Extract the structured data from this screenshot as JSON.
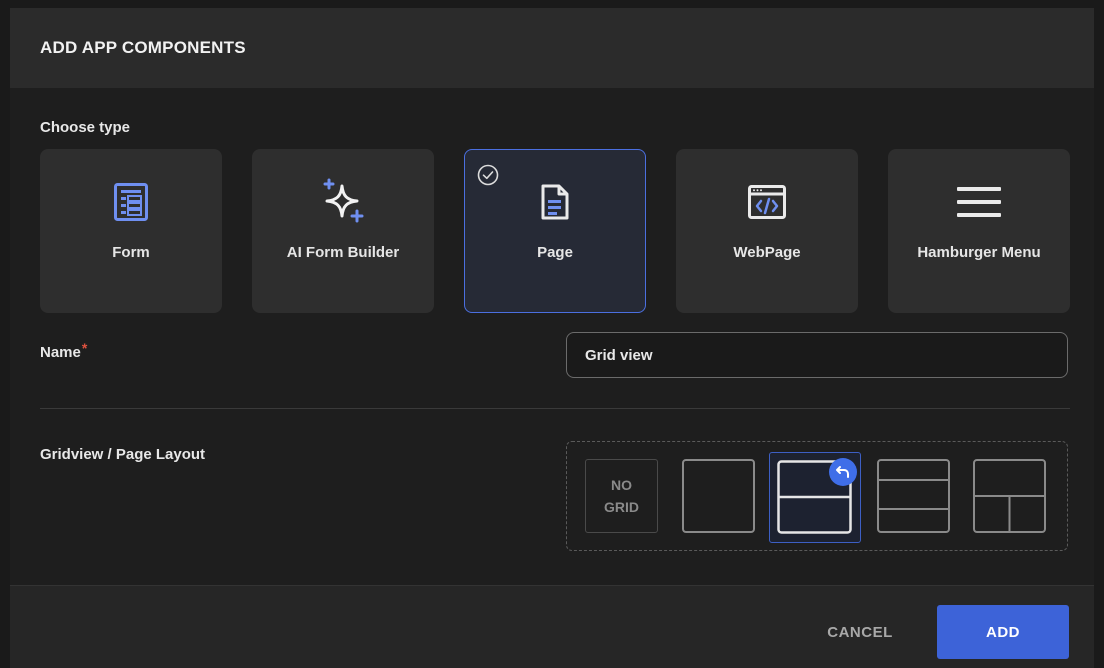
{
  "dialog": {
    "title": "ADD APP COMPONENTS"
  },
  "choose_type": {
    "label": "Choose type",
    "selected": "Page",
    "items": [
      {
        "label": "Form",
        "icon": "form-icon"
      },
      {
        "label": "AI Form Builder",
        "icon": "sparkle-icon"
      },
      {
        "label": "Page",
        "icon": "page-icon"
      },
      {
        "label": "WebPage",
        "icon": "webpage-icon"
      },
      {
        "label": "Hamburger Menu",
        "icon": "hamburger-icon"
      }
    ]
  },
  "name": {
    "label": "Name",
    "required_mark": "*",
    "value": "Grid view"
  },
  "layout": {
    "label": "Gridview / Page Layout",
    "no_grid_line1": "NO",
    "no_grid_line2": "GRID",
    "options": [
      "no-grid",
      "single",
      "two-rows",
      "three-rows",
      "top-and-two-bottom"
    ],
    "selected": "two-rows"
  },
  "footer": {
    "cancel_label": "CANCEL",
    "add_label": "ADD"
  },
  "colors": {
    "accent": "#3d63d8",
    "required": "#e0523f",
    "selected_border": "#4b6fe0"
  }
}
